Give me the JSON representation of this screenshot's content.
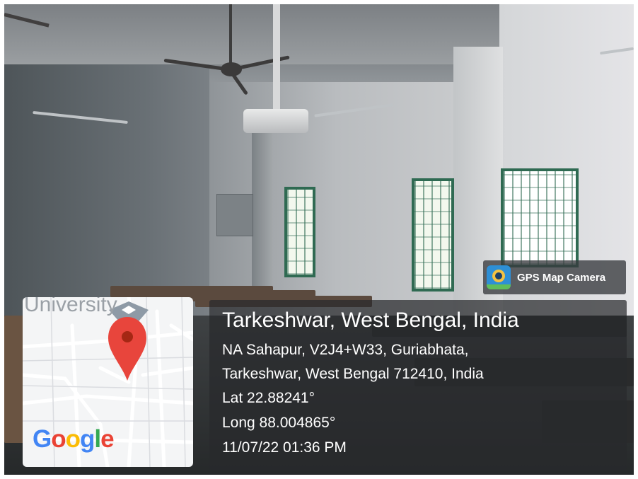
{
  "map": {
    "place_label": "University",
    "logo": "Google",
    "pin_icon": "map-pin-icon",
    "pin_color": "#e8453c",
    "logo_colors": [
      "#4285f4",
      "#ea4335",
      "#fbbc05",
      "#4285f4",
      "#34a853",
      "#ea4335"
    ]
  },
  "overlay": {
    "app_name": "GPS Map Camera",
    "app_icon": "gps-camera-icon",
    "title": "Tarkeshwar, West Bengal, India",
    "address_line1": "NA Sahapur, V2J4+W33, Guriabhata,",
    "address_line2": "Tarkeshwar, West Bengal 712410, India",
    "latitude": "Lat 22.88241°",
    "longitude": "Long 88.004865°",
    "datetime": "11/07/22 01:36 PM"
  }
}
